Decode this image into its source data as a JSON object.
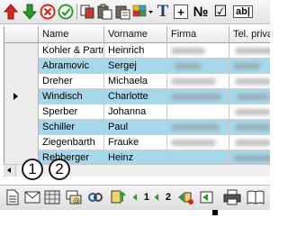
{
  "toolbar": {
    "buttons": [
      {
        "name": "move-up-icon",
        "color": "#d8261e"
      },
      {
        "name": "move-down-icon",
        "color": "#2f9a2b"
      },
      {
        "name": "delete-icon",
        "color": "#d8261e"
      },
      {
        "name": "confirm-icon",
        "color": "#2f9a2b"
      },
      {
        "name": "copy-icon"
      },
      {
        "name": "paste-icon"
      },
      {
        "name": "paste-special-icon"
      },
      {
        "name": "format-color-icon"
      },
      {
        "name": "font-text-icon"
      },
      {
        "name": "add-field-icon"
      },
      {
        "name": "numero-icon"
      },
      {
        "name": "checkbox-icon"
      },
      {
        "name": "textbox-icon"
      }
    ],
    "font_symbol": "T",
    "add_symbol": "+",
    "numero_symbol": "№",
    "check_symbol": "☑",
    "textbox_symbol": "ab|"
  },
  "grid": {
    "columns": [
      "Name",
      "Vorname",
      "Firma",
      "Tel. privat"
    ],
    "selected_row": 3,
    "rows": [
      {
        "name": "Kohler & Partner",
        "vorname": "Heinrich"
      },
      {
        "name": "Abramovic",
        "vorname": "Sergej"
      },
      {
        "name": "Dreher",
        "vorname": "Michaela"
      },
      {
        "name": "Windisch",
        "vorname": "Charlotte"
      },
      {
        "name": "Sperber",
        "vorname": "Johanna"
      },
      {
        "name": "Schiller",
        "vorname": "Paul"
      },
      {
        "name": "Ziegenbarth",
        "vorname": "Frauke"
      },
      {
        "name": "Rehberger",
        "vorname": "Heinz"
      }
    ]
  },
  "callouts": [
    "1",
    "2"
  ],
  "bottom_toolbar": {
    "buttons": [
      "document-icon",
      "envelope-icon",
      "envelope-grid-icon",
      "group-email-icon",
      "link-icon",
      "sort-ascending-icon",
      "sort-1-icon",
      "sort-2-icon",
      "sort-delete-icon",
      "flag-icon",
      "printer-icon",
      "book-icon"
    ],
    "sort_one": "1",
    "sort_two": "2"
  }
}
